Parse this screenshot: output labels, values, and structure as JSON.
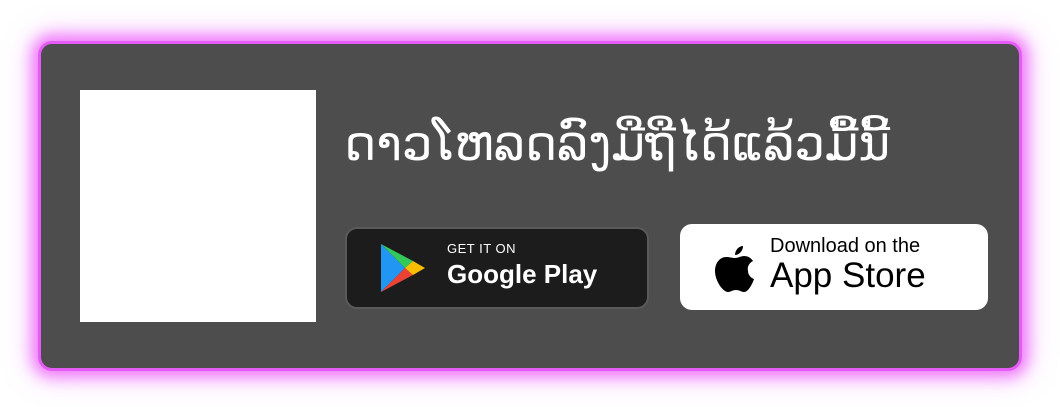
{
  "headline": "ດາວໂຫລດລົງມືຖືໄດ້ແລ້ວມື້ນີ້",
  "google_play": {
    "small": "GET IT ON",
    "big": "Google Play",
    "icon": "google-play-icon"
  },
  "app_store": {
    "small": "Download on the",
    "big": "App Store",
    "icon": "apple-icon"
  },
  "colors": {
    "panel": "#4d4d4d",
    "glow": "#e45cf5"
  }
}
